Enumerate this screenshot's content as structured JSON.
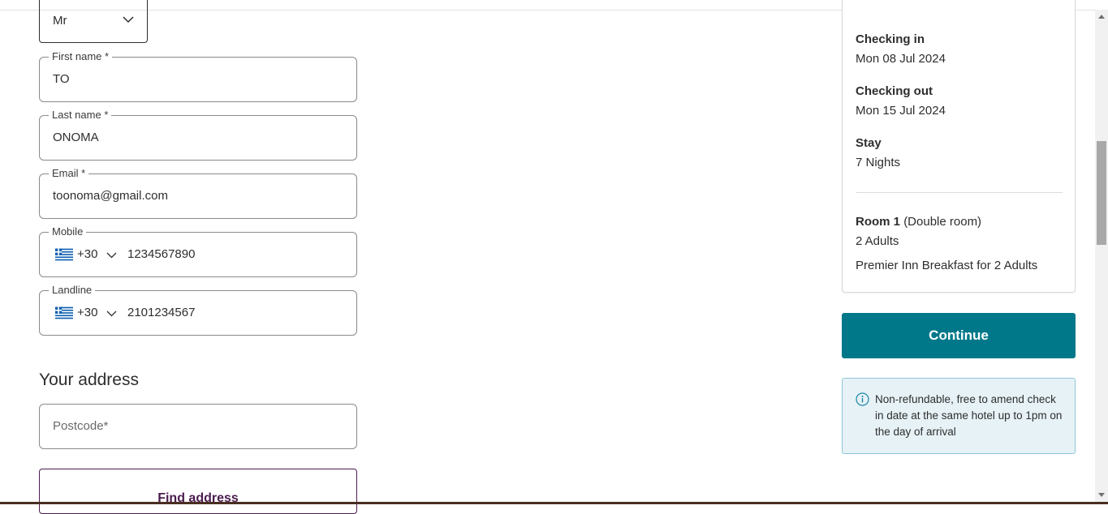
{
  "form": {
    "title_select": {
      "value": "Mr"
    },
    "first_name": {
      "label": "First name *",
      "value": "TO"
    },
    "last_name": {
      "label": "Last name *",
      "value": "ONOMA"
    },
    "email": {
      "label": "Email *",
      "value": "toonoma@gmail.com"
    },
    "mobile": {
      "label": "Mobile",
      "country_flag": "greece-flag",
      "country_code": "+30",
      "value": "1234567890"
    },
    "landline": {
      "label": "Landline",
      "country_flag": "greece-flag",
      "country_code": "+30",
      "value": "2101234567"
    },
    "address_section_title": "Your address",
    "postcode": {
      "placeholder": "Postcode*",
      "value": ""
    },
    "find_address_label": "Find address"
  },
  "summary": {
    "checking_in_label": "Checking in",
    "checking_in_value": "Mon 08 Jul 2024",
    "checking_out_label": "Checking out",
    "checking_out_value": "Mon 15 Jul 2024",
    "stay_label": "Stay",
    "stay_value": "7 Nights",
    "room_label": "Room 1",
    "room_type": "(Double room)",
    "guests": "2 Adults",
    "extras": "Premier Inn Breakfast for 2 Adults"
  },
  "actions": {
    "continue_label": "Continue"
  },
  "notice": {
    "icon": "info-icon",
    "text": "Non-refundable, free to amend check in date at the same hotel up to 1pm on the day of arrival"
  },
  "colors": {
    "primary": "#00788a",
    "secondary": "#4b1c4f",
    "info_bg": "#e6f2f6"
  }
}
